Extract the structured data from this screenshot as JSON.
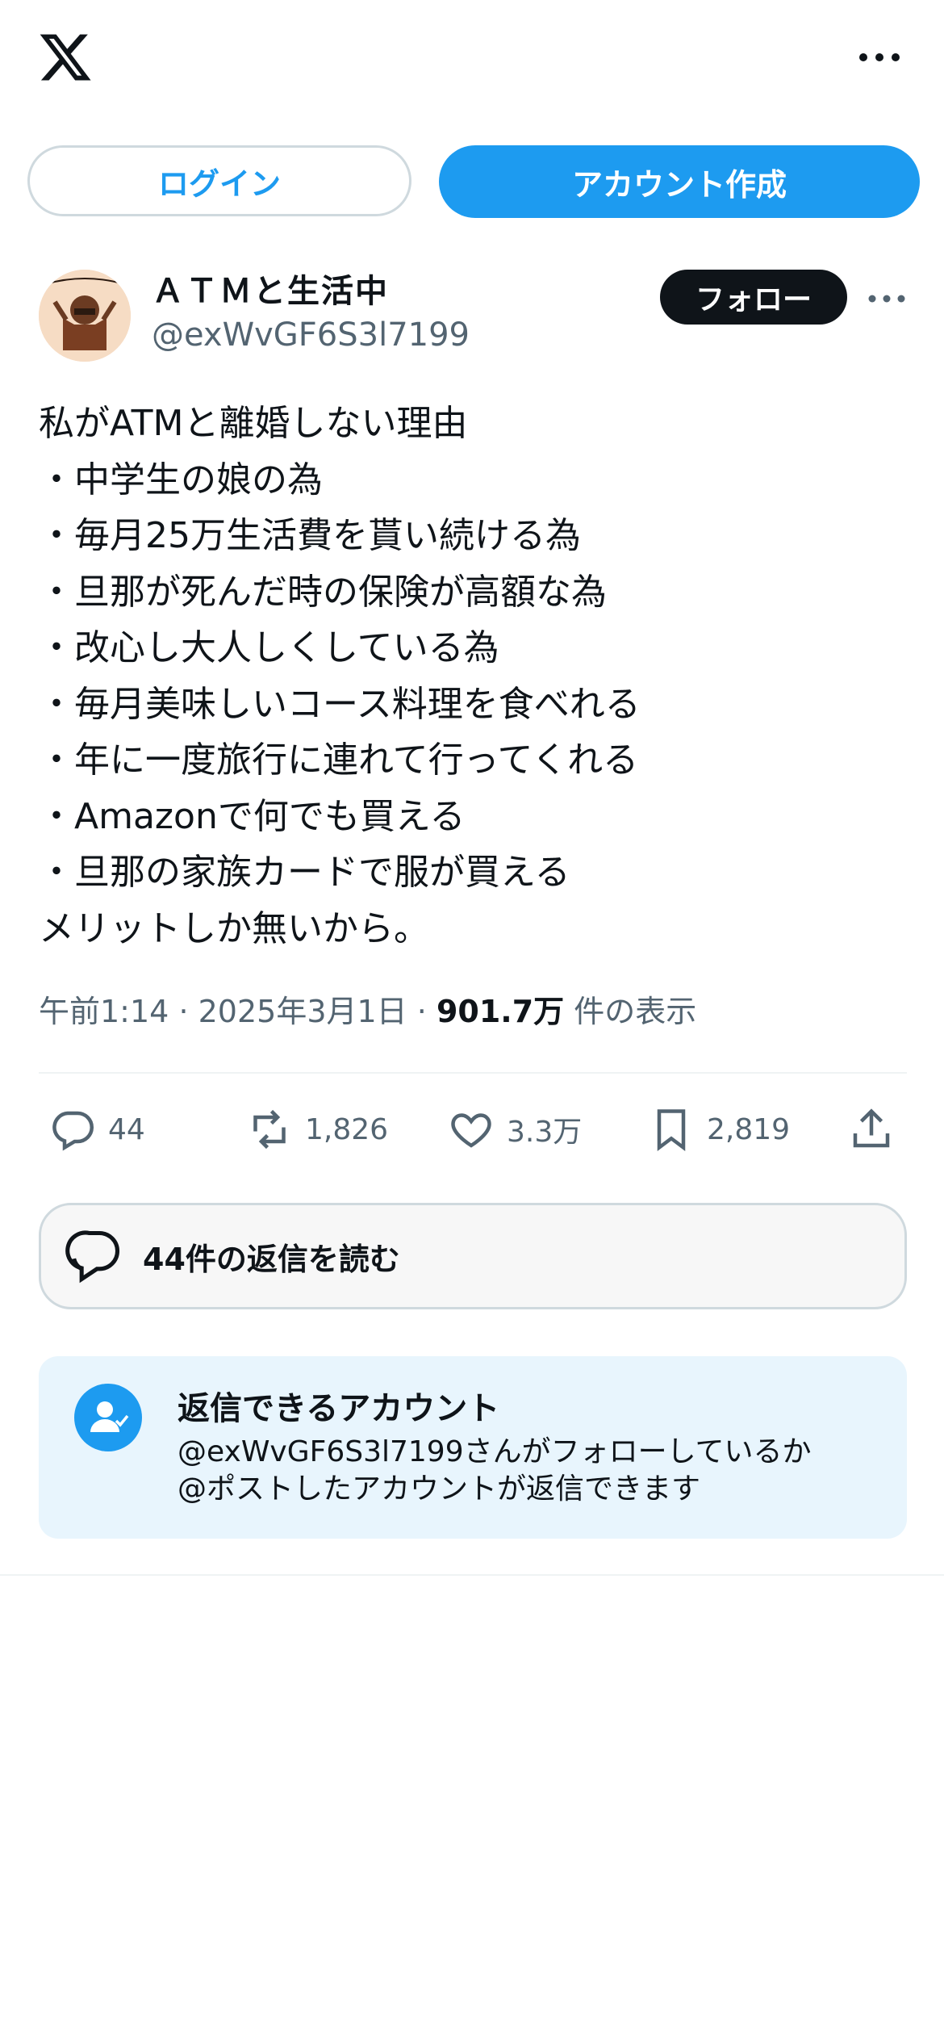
{
  "header": {
    "logo_icon": "x-logo-icon",
    "more_icon": "more-horizontal-icon",
    "login_label": "ログイン",
    "signup_label": "アカウント作成"
  },
  "tweet": {
    "author": {
      "display_name": "ＡＴＭと生活中",
      "handle": "@exWvGF6S3l7199",
      "avatar_icon": "avatar-image"
    },
    "follow_label": "フォロー",
    "lines": [
      "私がATMと離婚しない理由",
      "・中学生の娘の為",
      "・毎月25万生活費を貰い続ける為",
      "・旦那が死んだ時の保険が高額な為",
      "・改心し大人しくしている為",
      "・毎月美味しいコース料理を食べれる",
      "・年に一度旅行に連れて行ってくれる",
      "・Amazonで何でも買える",
      "・旦那の家族カードで服が買える",
      "メリットしか無いから。"
    ],
    "time": "午前1:14",
    "date": "2025年3月1日",
    "views_count": "901.7万",
    "views_label": "件の表示",
    "separator": "·"
  },
  "actions": {
    "replies": "44",
    "reposts": "1,826",
    "likes": "3.3万",
    "bookmarks": "2,819"
  },
  "read_replies_label": "44件の返信を読む",
  "reply_settings": {
    "title": "返信できるアカウント",
    "line1": "@exWvGF6S3l7199さんがフォローしているか",
    "line2": "@ポストしたアカウントが返信できます"
  },
  "colors": {
    "accent": "#1d9bf0",
    "text": "#0f1419",
    "secondary": "#536471",
    "card_bg": "#e8f5fd"
  }
}
